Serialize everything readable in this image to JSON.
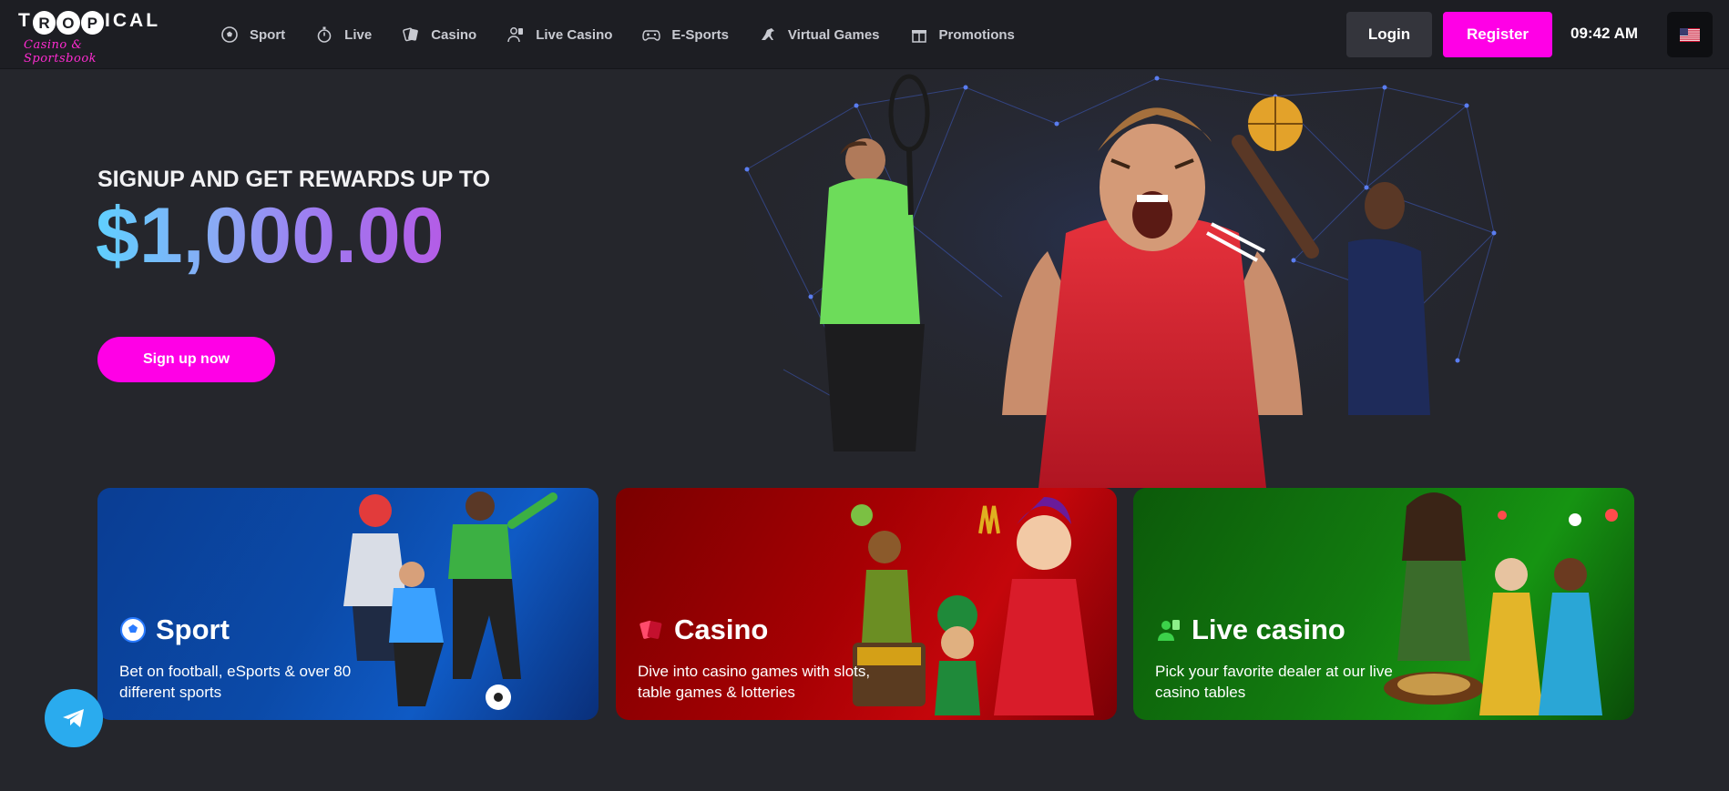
{
  "header": {
    "logo": {
      "title_letters": [
        "T",
        "R",
        "O",
        "P",
        "I",
        "C",
        "A",
        "L"
      ],
      "subtitle": "Casino & Sportsbook"
    },
    "nav": [
      {
        "label": "Sport",
        "icon": "soccer-ball-icon"
      },
      {
        "label": "Live",
        "icon": "stopwatch-icon"
      },
      {
        "label": "Casino",
        "icon": "cards-icon"
      },
      {
        "label": "Live Casino",
        "icon": "dealer-icon"
      },
      {
        "label": "E-Sports",
        "icon": "gamepad-icon"
      },
      {
        "label": "Virtual Games",
        "icon": "horse-icon"
      },
      {
        "label": "Promotions",
        "icon": "gift-icon"
      }
    ],
    "login_label": "Login",
    "register_label": "Register",
    "time": "09:42 AM",
    "language_icon": "us-flag-icon"
  },
  "hero": {
    "tagline": "SIGNUP AND GET REWARDS UP TO",
    "amount": "$1,000.00",
    "cta_label": "Sign up now"
  },
  "cards": [
    {
      "title": "Sport",
      "description": "Bet on football, eSports & over 80 different sports",
      "icon": "soccer-ball-icon"
    },
    {
      "title": "Casino",
      "description": "Dive into casino games with slots, table games & lotteries",
      "icon": "cards-icon"
    },
    {
      "title": "Live casino",
      "description": "Pick your favorite dealer at our live casino tables",
      "icon": "dealer-icon"
    }
  ],
  "colors": {
    "accent": "#ff00e6",
    "header_bg": "#1d1e23",
    "page_bg": "#25262c",
    "sport_card": "#0b4aa8",
    "casino_card": "#a60003",
    "live_card": "#127a0f",
    "telegram": "#2aabee"
  },
  "floating": {
    "icon": "telegram-icon"
  }
}
